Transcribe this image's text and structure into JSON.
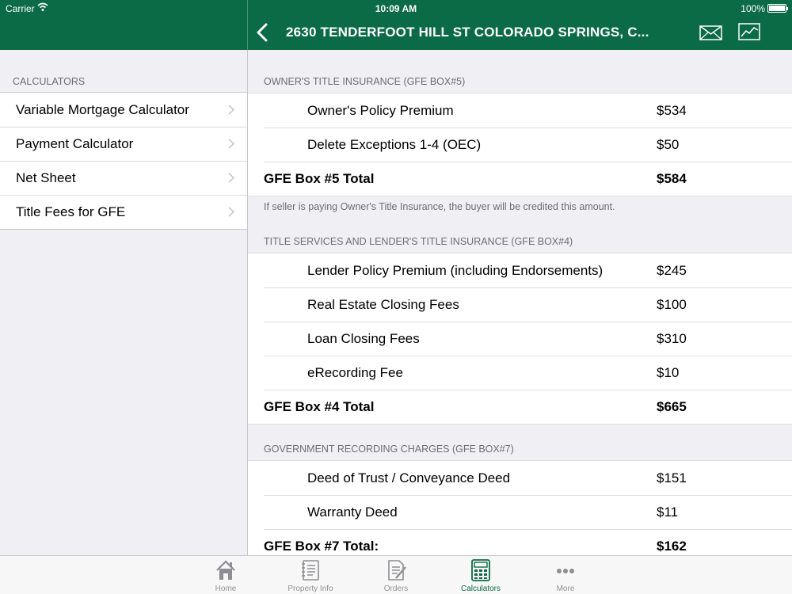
{
  "status_bar": {
    "carrier": "Carrier",
    "time": "10:09 AM",
    "battery": "100%"
  },
  "nav": {
    "title": "2630 TENDERFOOT HILL ST  COLORADO SPRINGS, C..."
  },
  "sidebar": {
    "header": "CALCULATORS",
    "items": [
      {
        "label": "Variable Mortgage Calculator"
      },
      {
        "label": "Payment Calculator"
      },
      {
        "label": "Net Sheet"
      },
      {
        "label": "Title Fees for GFE"
      }
    ]
  },
  "sections": [
    {
      "header": "OWNER'S TITLE INSURANCE (GFE BOX#5)",
      "rows": [
        {
          "name": "Owner's Policy Premium",
          "amount": "$534"
        },
        {
          "name": "Delete Exceptions 1-4 (OEC)",
          "amount": "$50"
        }
      ],
      "total": {
        "name": "GFE Box #5 Total",
        "amount": "$584"
      },
      "note": "If seller is paying Owner's Title Insurance, the buyer will be credited this amount."
    },
    {
      "header": "TITLE SERVICES AND LENDER'S TITLE INSURANCE (GFE BOX#4)",
      "rows": [
        {
          "name": "Lender Policy Premium (including Endorsements)",
          "amount": "$245"
        },
        {
          "name": "Real Estate Closing Fees",
          "amount": "$100"
        },
        {
          "name": "Loan Closing Fees",
          "amount": "$310"
        },
        {
          "name": "eRecording Fee",
          "amount": "$10"
        }
      ],
      "total": {
        "name": "GFE Box #4 Total",
        "amount": "$665"
      }
    },
    {
      "header": "GOVERNMENT RECORDING CHARGES (GFE BOX#7)",
      "rows": [
        {
          "name": "Deed of Trust / Conveyance Deed",
          "amount": "$151"
        },
        {
          "name": "Warranty Deed",
          "amount": "$11"
        }
      ],
      "total": {
        "name": "GFE Box #7 Total:",
        "amount": "$162"
      }
    }
  ],
  "tabbar": {
    "tabs": [
      {
        "label": "Home",
        "icon": "home-icon"
      },
      {
        "label": "Property Info",
        "icon": "property-info-icon"
      },
      {
        "label": "Orders",
        "icon": "orders-icon"
      },
      {
        "label": "Calculators",
        "icon": "calculator-icon",
        "active": true
      },
      {
        "label": "More",
        "icon": "more-icon"
      }
    ]
  },
  "colors": {
    "brand_green": "#0b6b47",
    "background": "#efeff4",
    "separator": "#dcdce0"
  }
}
